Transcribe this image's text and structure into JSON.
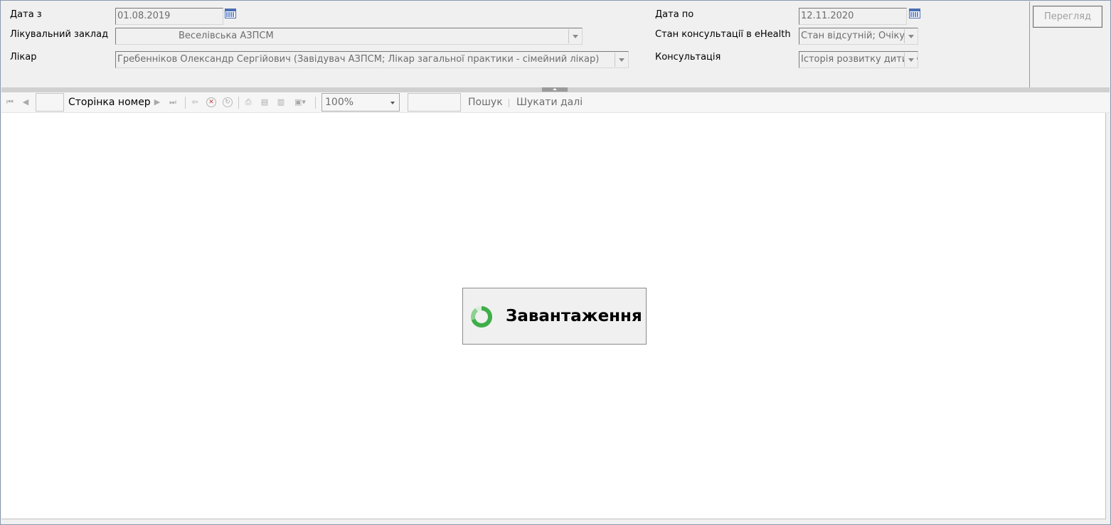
{
  "filters": {
    "date_from_label": "Дата з",
    "date_from_value": "01.08.2019",
    "facility_label": "Лікувальний заклад",
    "facility_value": "Веселівська АЗПСМ",
    "doctor_label": "Лікар",
    "doctor_value": "Гребенніков Олександр Сергійович (Завідувач АЗПСМ; Лікар загальної практики - сімейний лікар)",
    "date_to_label": "Дата по",
    "date_to_value": "12.11.2020",
    "ehealth_status_label": "Стан консультації в eHealth",
    "ehealth_status_value": "Стан відсутній; Очікує",
    "consultation_label": "Консультація",
    "consultation_value": "Історія розвитку дитини"
  },
  "actions": {
    "view_label": "Перегляд"
  },
  "toolbar": {
    "page_number_label": "Сторінка номер",
    "page_number_value": "",
    "zoom_value": "100%",
    "search_value": "",
    "search_label": "Пошук",
    "find_next_label": "Шукати далі",
    "icons": [
      "first-page-icon",
      "prev-page-icon",
      "next-page-icon",
      "last-page-icon",
      "back-icon",
      "stop-icon",
      "refresh-icon",
      "print-icon",
      "print-layout-icon",
      "page-setup-icon",
      "export-icon"
    ]
  },
  "report": {
    "loading_text": "Завантаження"
  },
  "colors": {
    "spinner": "#3fae49",
    "calendar": "#4a6fb3"
  }
}
